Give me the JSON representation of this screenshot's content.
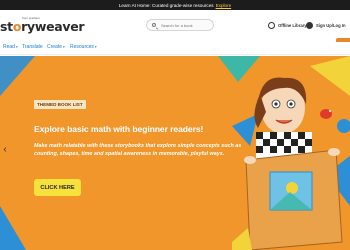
{
  "topbar": {
    "message": "Learn At Home: Curated grade-wise resources",
    "link_label": "Explore"
  },
  "header": {
    "logo_word_before": "st",
    "logo_word_o": "o",
    "logo_word_after": "ryweaver",
    "logo_tagline": "from pratham",
    "search_placeholder": "Search for a book",
    "offline_library_label": "Offline Library",
    "signup_label": "Sign Up/Log In"
  },
  "nav": {
    "items": [
      {
        "label": "Read"
      },
      {
        "label": "Translate"
      },
      {
        "label": "Create"
      },
      {
        "label": "Resources"
      }
    ],
    "caret": "▾"
  },
  "hero": {
    "badge": "THEMED BOOK LIST",
    "title": "Explore basic math with beginner readers!",
    "body": "Make math relatable with these storybooks that explore simple concepts such as counting, shapes, time and spatial awareness in memorable, playful ways.",
    "cta_label": "CLICK HERE",
    "prev_glyph": "‹",
    "colors": {
      "background": "#f0962a",
      "cta": "#f6e23b",
      "badge_bg": "#fbe6c4"
    }
  },
  "icons": {
    "search": "search-icon",
    "offline": "offline-library-icon",
    "signup": "user-icon",
    "prev": "chevron-left-icon"
  }
}
